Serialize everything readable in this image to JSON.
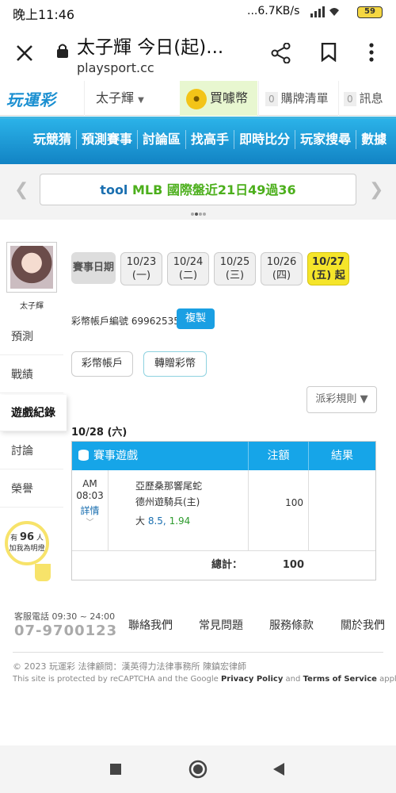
{
  "status_bar": {
    "time": "晚上11:46",
    "network": "...6.7KB/s",
    "battery": "59"
  },
  "browser": {
    "title": "太子輝 今日(起)...",
    "url": "playsport.cc"
  },
  "header": {
    "logo": "玩運彩",
    "user": "太子輝",
    "buy_coins": "買噱幣",
    "cart_count": "0",
    "cart": "購牌清單",
    "messages_count": "0",
    "messages": "訊息"
  },
  "nav": {
    "items": [
      "玩競猜",
      "預測賽事",
      "討論區",
      "找高手",
      "即時比分",
      "玩家搜尋",
      "數據"
    ]
  },
  "banner": {
    "text_tool": "tool",
    "text_rest": "MLB 國際盤近21日49過36"
  },
  "sidebar": {
    "username": "太子輝",
    "items": [
      "預測",
      "戰績",
      "遊戲紀錄",
      "討論",
      "榮譽"
    ],
    "active_item": "遊戲紀錄",
    "bulb_prefix": "有",
    "bulb_count": "96",
    "bulb_unit": "人",
    "bulb_text": "加我為明燈"
  },
  "main": {
    "date_label": "賽事日期",
    "dates": [
      {
        "date": "10/23",
        "day": "(一)"
      },
      {
        "date": "10/24",
        "day": "(二)"
      },
      {
        "date": "10/25",
        "day": "(三)"
      },
      {
        "date": "10/26",
        "day": "(四)"
      },
      {
        "date": "10/27",
        "day": "(五) 起"
      }
    ],
    "account_label": "彩幣帳戶編號 69962535",
    "copy": "複製",
    "wallet": "彩幣帳戶",
    "transfer": "轉贈彩幣",
    "rules": "派彩規則",
    "game_date": "10/28 (六)",
    "table": {
      "headers": [
        "賽事遊戲",
        "注額",
        "結果"
      ],
      "row": {
        "ampm": "AM",
        "time": "08:03",
        "detail": "詳情",
        "team_away": "亞歷桑那響尾蛇",
        "team_home": "德州遊騎兵(主)",
        "bet_label": "大",
        "bet_line": "8.5,",
        "bet_odds": "1.94",
        "amount": "100",
        "result": ""
      },
      "total_label": "總計：",
      "total_amount": "100"
    }
  },
  "footer": {
    "hotline_label": "客服電話 09:30 ~ 24:00",
    "hotline": "07-9700123",
    "links": [
      "聯絡我們",
      "常見問題",
      "服務條款",
      "關於我們"
    ],
    "copyright": "© 2023 玩運彩 法律顧問：漢英得力法律事務所 陳鎮宏律師",
    "recaptcha_prefix": "This site is protected by reCAPTCHA and the Google",
    "privacy": "Privacy Policy",
    "and": "and",
    "terms": "Terms of Service",
    "apply": "apply."
  }
}
